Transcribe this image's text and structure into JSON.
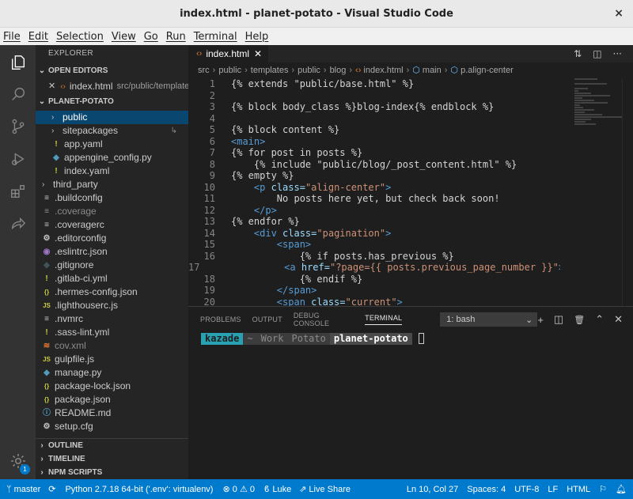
{
  "window": {
    "title": "index.html - planet-potato - Visual Studio Code",
    "close": "×"
  },
  "menu": [
    "File",
    "Edit",
    "Selection",
    "View",
    "Go",
    "Run",
    "Terminal",
    "Help"
  ],
  "explorer": {
    "title": "EXPLORER",
    "open_editors": {
      "label": "OPEN EDITORS",
      "item": "index.html",
      "path": "src/public/templates/..."
    },
    "project": "PLANET-POTATO",
    "items": [
      {
        "label": "public",
        "type": "folder-open",
        "indent": 1,
        "selected": true
      },
      {
        "label": "sitepackages",
        "type": "folder",
        "indent": 1
      },
      {
        "label": "app.yaml",
        "type": "yaml",
        "indent": 1
      },
      {
        "label": "appengine_config.py",
        "type": "py",
        "indent": 1
      },
      {
        "label": "index.yaml",
        "type": "yaml",
        "indent": 1
      },
      {
        "label": "third_party",
        "type": "folder",
        "indent": 0
      },
      {
        "label": ".buildconfig",
        "type": "config",
        "indent": 0
      },
      {
        "label": ".coverage",
        "type": "config-dim",
        "indent": 0
      },
      {
        "label": ".coveragerc",
        "type": "config",
        "indent": 0
      },
      {
        "label": ".editorconfig",
        "type": "gear",
        "indent": 0
      },
      {
        "label": ".eslintrc.json",
        "type": "eslint",
        "indent": 0
      },
      {
        "label": ".gitignore",
        "type": "git",
        "indent": 0
      },
      {
        "label": ".gitlab-ci.yml",
        "type": "yaml",
        "indent": 0
      },
      {
        "label": ".hermes-config.json",
        "type": "json",
        "indent": 0
      },
      {
        "label": ".lighthouserc.js",
        "type": "js",
        "indent": 0
      },
      {
        "label": ".nvmrc",
        "type": "config",
        "indent": 0
      },
      {
        "label": ".sass-lint.yml",
        "type": "yaml",
        "indent": 0
      },
      {
        "label": "cov.xml",
        "type": "xml",
        "indent": 0
      },
      {
        "label": "gulpfile.js",
        "type": "js",
        "indent": 0
      },
      {
        "label": "manage.py",
        "type": "py",
        "indent": 0
      },
      {
        "label": "package-lock.json",
        "type": "json",
        "indent": 0
      },
      {
        "label": "package.json",
        "type": "json",
        "indent": 0
      },
      {
        "label": "README.md",
        "type": "info",
        "indent": 0
      },
      {
        "label": "setup.cfg",
        "type": "gear",
        "indent": 0
      }
    ],
    "sections": [
      "OUTLINE",
      "TIMELINE",
      "NPM SCRIPTS"
    ]
  },
  "editor": {
    "tab": "index.html",
    "breadcrumb": [
      "src",
      "public",
      "templates",
      "public",
      "blog",
      "index.html",
      "main",
      "p.align-center"
    ],
    "lines": [
      {
        "n": "1",
        "segs": [
          [
            "t-txt",
            "{% extends \"public/base.html\" %}"
          ]
        ]
      },
      {
        "n": "2",
        "segs": []
      },
      {
        "n": "3",
        "segs": [
          [
            "t-txt",
            "{% block body_class %}blog-index{% endblock %}"
          ]
        ]
      },
      {
        "n": "4",
        "segs": []
      },
      {
        "n": "5",
        "segs": [
          [
            "t-txt",
            "{% block content %}"
          ]
        ]
      },
      {
        "n": "6",
        "segs": [
          [
            "t-tag",
            "<main>"
          ]
        ]
      },
      {
        "n": "7",
        "segs": [
          [
            "t-txt",
            "{% for post in posts %}"
          ]
        ]
      },
      {
        "n": "8",
        "segs": [
          [
            "t-txt",
            "    {% include \"public/blog/_post_content.html\" %}"
          ]
        ]
      },
      {
        "n": "9",
        "segs": [
          [
            "t-txt",
            "{% empty %}"
          ]
        ]
      },
      {
        "n": "10",
        "segs": [
          [
            "t-txt",
            "    "
          ],
          [
            "t-tag",
            "<p "
          ],
          [
            "t-attr",
            "class="
          ],
          [
            "t-str",
            "\"align-center\""
          ],
          [
            "t-tag",
            ">"
          ]
        ]
      },
      {
        "n": "11",
        "segs": [
          [
            "t-txt",
            "        No posts here yet, but check back soon!"
          ]
        ]
      },
      {
        "n": "12",
        "segs": [
          [
            "t-txt",
            "    "
          ],
          [
            "t-tag",
            "</p>"
          ]
        ]
      },
      {
        "n": "13",
        "segs": [
          [
            "t-txt",
            "{% endfor %}"
          ]
        ]
      },
      {
        "n": "14",
        "segs": [
          [
            "t-txt",
            "    "
          ],
          [
            "t-tag",
            "<div "
          ],
          [
            "t-attr",
            "class="
          ],
          [
            "t-str",
            "\"pagination\""
          ],
          [
            "t-tag",
            ">"
          ]
        ]
      },
      {
        "n": "15",
        "segs": [
          [
            "t-txt",
            "        "
          ],
          [
            "t-tag",
            "<span>"
          ]
        ]
      },
      {
        "n": "16",
        "segs": [
          [
            "t-txt",
            "            {% if posts.has_previous %}"
          ]
        ]
      },
      {
        "n": "17",
        "segs": [
          [
            "t-txt",
            "            "
          ],
          [
            "t-tag",
            "<a "
          ],
          [
            "t-attr",
            "href="
          ],
          [
            "t-str",
            "\"?page={{ posts.previous_page_number }}\""
          ],
          [
            "t-tag",
            ">"
          ],
          [
            "t-txt",
            "&laquo"
          ]
        ]
      },
      {
        "n": "18",
        "segs": [
          [
            "t-txt",
            "            {% endif %}"
          ]
        ]
      },
      {
        "n": "19",
        "segs": [
          [
            "t-txt",
            "        "
          ],
          [
            "t-tag",
            "</span>"
          ]
        ]
      },
      {
        "n": "20",
        "segs": [
          [
            "t-txt",
            "        "
          ],
          [
            "t-tag",
            "<span "
          ],
          [
            "t-attr",
            "class="
          ],
          [
            "t-str",
            "\"current\""
          ],
          [
            "t-tag",
            ">"
          ]
        ]
      }
    ]
  },
  "panel": {
    "tabs": [
      "PROBLEMS",
      "OUTPUT",
      "DEBUG CONSOLE",
      "TERMINAL"
    ],
    "active_tab": "TERMINAL",
    "terminal_select": "1: bash",
    "prompt": [
      {
        "text": "kazade",
        "bg": "#2aa1b3",
        "fg": "#1e1e1e",
        "bold": true
      },
      {
        "text": "~",
        "bg": "#3c3c3c",
        "fg": "#8a8a8a"
      },
      {
        "text": "Work",
        "bg": "#3c3c3c",
        "fg": "#8a8a8a"
      },
      {
        "text": "Potato",
        "bg": "#3c3c3c",
        "fg": "#8a8a8a"
      },
      {
        "text": "planet-potato",
        "bg": "#4a4a4a",
        "fg": "#ffffff",
        "bold": true
      }
    ],
    "prompt_separator": ""
  },
  "status": {
    "branch": "master",
    "python": "Python 2.7.18 64-bit ('.env': virtualenv)",
    "errors": "0",
    "warnings": "0",
    "user": "Luke",
    "live_share": "Live Share",
    "position": "Ln 10, Col 27",
    "spaces": "Spaces: 4",
    "encoding": "UTF-8",
    "eol": "LF",
    "language": "HTML",
    "manage_badge": "1"
  },
  "colors": {
    "accent": "#007acc",
    "selection": "#094771"
  }
}
